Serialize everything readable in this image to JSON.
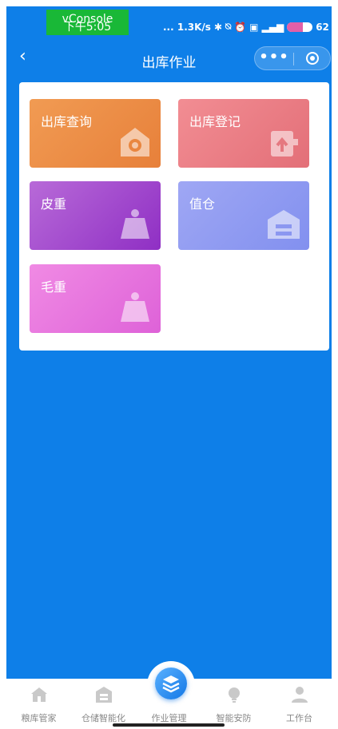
{
  "status_bar": {
    "vconsole_label": "vConsole",
    "time": "下午5:05",
    "network_speed": "... 1.3K/s",
    "icons": [
      "bluetooth-icon",
      "mute-icon",
      "alarm-icon",
      "hd-icon",
      "signal-icon"
    ],
    "battery_percent": "62",
    "battery_level": 0.62
  },
  "nav": {
    "title": "出库作业",
    "back_icon": "chevron-left-icon",
    "more_label": "•••",
    "capsule_icons": [
      "more-icon",
      "close-target-icon"
    ]
  },
  "tiles": [
    {
      "label": "出库查询",
      "icon": "home-search-icon",
      "color": "#ec8b47"
    },
    {
      "label": "出库登记",
      "icon": "upload-doc-icon",
      "color": "#ea7e86"
    },
    {
      "label": "皮重",
      "icon": "weight-icon",
      "color": "#a14ccc"
    },
    {
      "label": "值仓",
      "icon": "warehouse-icon",
      "color": "#8f9bf1"
    },
    {
      "label": "毛重",
      "icon": "weight-icon",
      "color": "#e877df"
    }
  ],
  "tabbar": {
    "items": [
      {
        "label": "粮库管家",
        "icon": "home-icon"
      },
      {
        "label": "仓储智能化",
        "icon": "warehouse-icon"
      },
      {
        "label": "作业管理",
        "icon": "layers-icon"
      },
      {
        "label": "智能安防",
        "icon": "bulb-icon"
      },
      {
        "label": "工作台",
        "icon": "user-icon"
      }
    ],
    "active_index": 2
  },
  "colors": {
    "primary_blue": "#0e7fe8",
    "vconsole_green": "#19b837",
    "tab_inactive": "#888888"
  }
}
